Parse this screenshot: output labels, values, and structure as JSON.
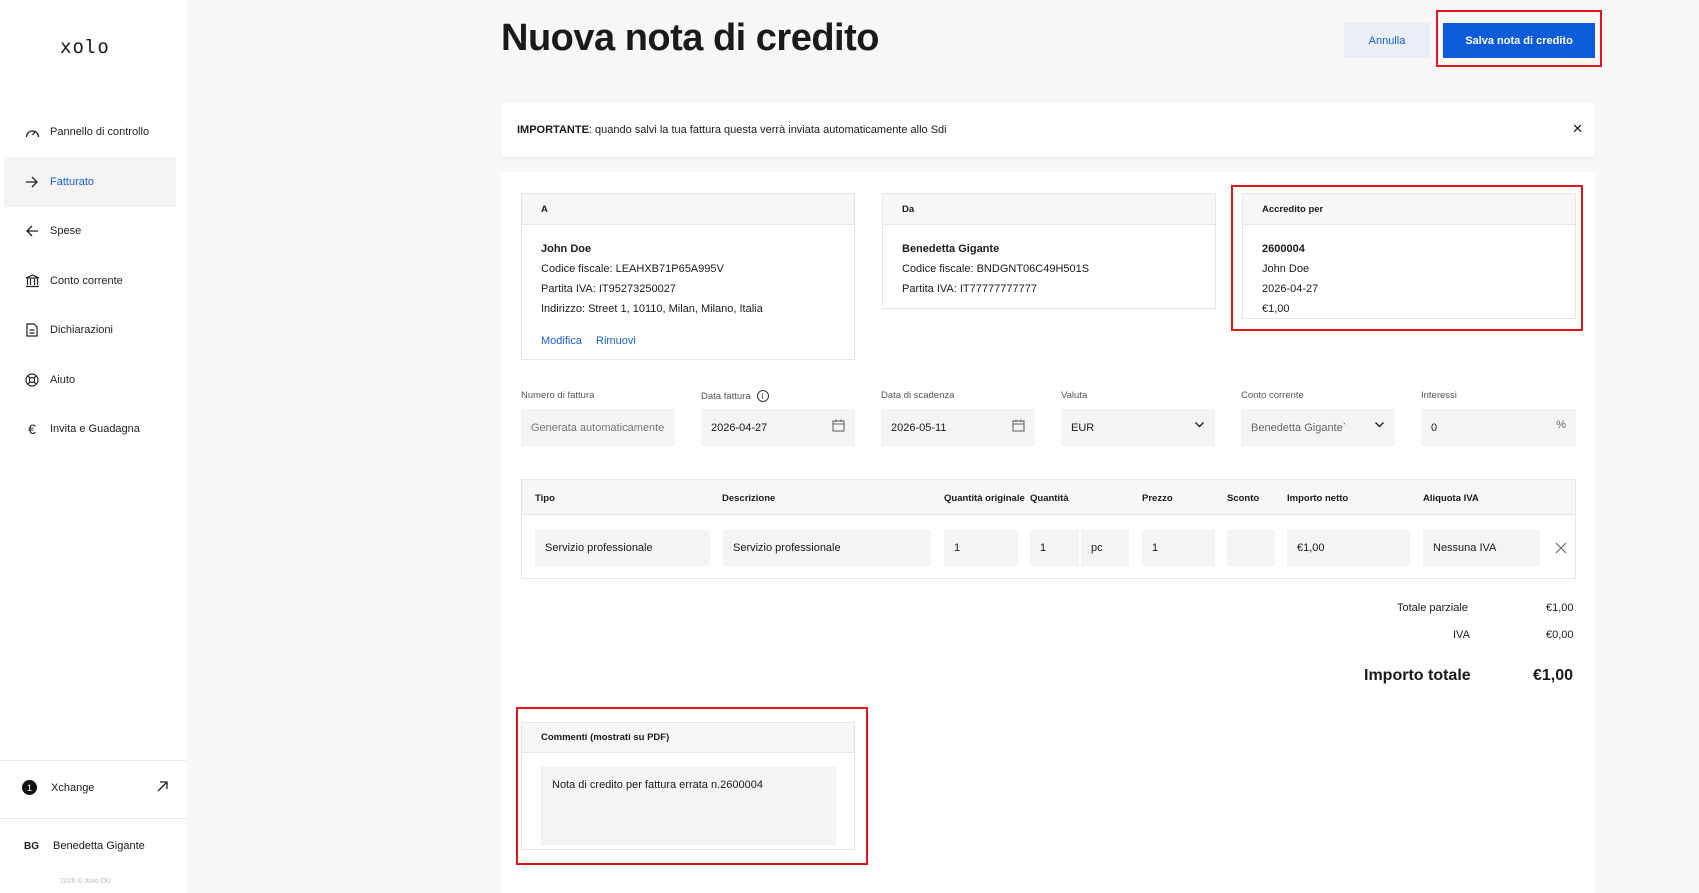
{
  "sidebar": {
    "logo": "xolo",
    "items": [
      {
        "label": "Pannello di controllo",
        "icon": "gauge-icon"
      },
      {
        "label": "Fatturato",
        "icon": "arrow-right-icon"
      },
      {
        "label": "Spese",
        "icon": "arrow-left-icon"
      },
      {
        "label": "Conto corrente",
        "icon": "bank-icon"
      },
      {
        "label": "Dichiarazioni",
        "icon": "document-icon"
      },
      {
        "label": "Aiuto",
        "icon": "lifebuoy-icon"
      },
      {
        "label": "Invita e Guadagna",
        "icon": "euro-icon"
      }
    ],
    "xchange": {
      "badge": "1",
      "label": "Xchange"
    },
    "user": {
      "initials": "BG",
      "name": "Benedetta Gigante"
    },
    "copyright": "2026 © Xolo OÜ"
  },
  "page": {
    "title": "Nuova nota di credito",
    "cancel_label": "Annulla",
    "save_label": "Salva nota di credito"
  },
  "notice": {
    "strong": "IMPORTANTE",
    "text": ": quando salvi la tua fattura questa verrà inviata automaticamente allo Sdi"
  },
  "to_card": {
    "header": "A",
    "name": "John Doe",
    "codice_fiscale": "Codice fiscale: LEAHXB71P65A995V",
    "partita_iva": "Partita IVA: IT95273250027",
    "indirizzo": "Indirizzo: Street 1, 10110, Milan, Milano, Italia",
    "edit_label": "Modifica",
    "remove_label": "Rimuovi"
  },
  "from_card": {
    "header": "Da",
    "name": "Benedetta Gigante",
    "codice_fiscale": "Codice fiscale: BNDGNT06C49H501S",
    "partita_iva": "Partita IVA: IT77777777777"
  },
  "credit_card": {
    "header": "Accredito per",
    "number": "2600004",
    "client": "John Doe",
    "date": "2026-04-27",
    "amount": "€1,00"
  },
  "fields": {
    "numero_label": "Numero di fattura",
    "numero_placeholder": "Generata automaticamente",
    "data_label": "Data fattura",
    "data_value": "2026-04-27",
    "scadenza_label": "Data di scadenza",
    "scadenza_value": "2026-05-11",
    "valuta_label": "Valuta",
    "valuta_value": "EUR",
    "conto_label": "Conto corrente",
    "conto_value": "Benedetta Gigante`",
    "interessi_label": "Interessi",
    "interessi_value": "0",
    "interessi_unit": "%"
  },
  "table": {
    "headers": {
      "tipo": "Tipo",
      "descrizione": "Descrizione",
      "qta_orig": "Quantità originale",
      "qta": "Quantità",
      "prezzo": "Prezzo",
      "sconto": "Sconto",
      "netto": "Importo netto",
      "aliquota": "Aliquota IVA"
    },
    "row": {
      "tipo": "Servizio professionale",
      "descrizione": "Servizio professionale",
      "qta_orig": "1",
      "qta": "1",
      "unit": "pc",
      "prezzo": "1",
      "sconto": "",
      "netto": "€1,00",
      "aliquota": "Nessuna IVA"
    }
  },
  "totals": {
    "subtotal_label": "Totale parziale",
    "subtotal_value": "€1,00",
    "iva_label": "IVA",
    "iva_value": "€0,00",
    "total_label": "Importo totale",
    "total_value": "€1,00"
  },
  "comments": {
    "header": "Commenti (mostrati su PDF)",
    "text": "Nota di credito per fattura errata n.2600004"
  }
}
